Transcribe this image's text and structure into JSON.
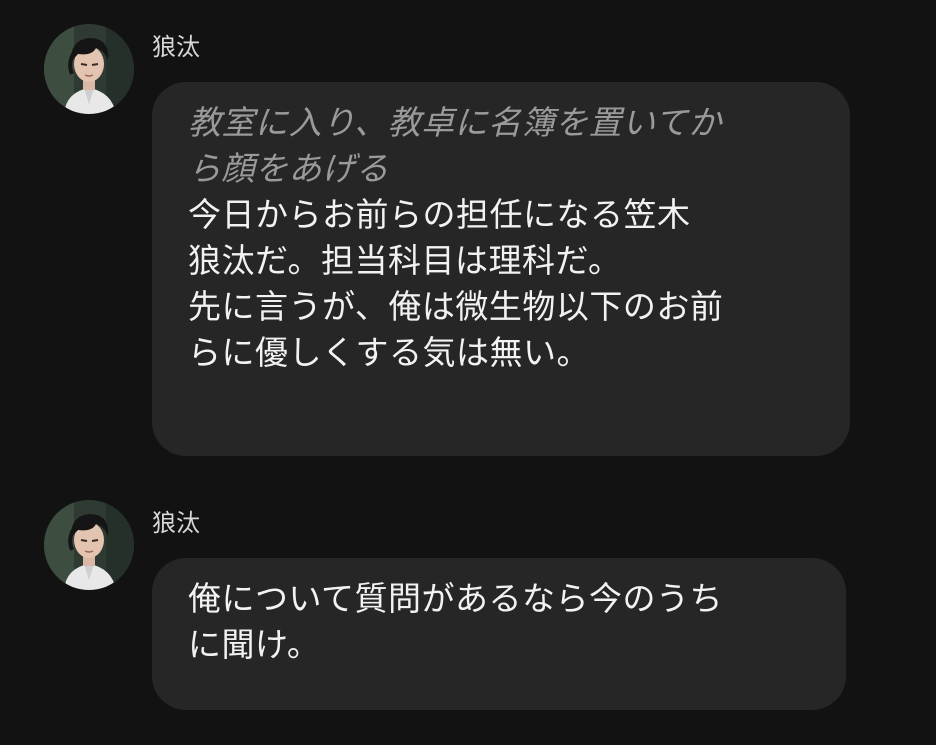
{
  "messages": [
    {
      "sender": "狼汰",
      "avatar_icon": "character-avatar",
      "action_lines": [
        "教室に入り、教卓に名簿を置いてか",
        "ら顔をあげる"
      ],
      "text_lines": [
        "今日からお前らの担任になる笠木",
        "狼汰だ。担当科目は理科だ。",
        "先に言うが、俺は微生物以下のお前",
        "らに優しくする気は無い。"
      ]
    },
    {
      "sender": "狼汰",
      "avatar_icon": "character-avatar",
      "text_lines": [
        "俺について質問があるなら今のうち",
        "に聞け。"
      ]
    }
  ],
  "colors": {
    "background": "#121212",
    "bubble": "#262626",
    "action_text": "#9a9a9a",
    "message_text": "#f2f2f2"
  }
}
